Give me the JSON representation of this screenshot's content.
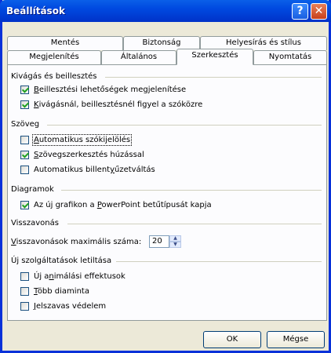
{
  "window": {
    "title": "Beállítások",
    "help_glyph": "?",
    "close_glyph": "✕"
  },
  "tabs": {
    "back_row": [
      "Mentés",
      "Biztonság",
      "Helyesírás és stílus"
    ],
    "front_row": [
      "Megjelenítés",
      "Általános",
      "Szerkesztés",
      "Nyomtatás"
    ],
    "active": "Szerkesztés"
  },
  "groups": {
    "cut_paste": {
      "label": "Kivágás és beillesztés",
      "items": [
        {
          "pre": "",
          "key": "B",
          "post": "eillesztési lehetőségek megjelenítése",
          "checked": true
        },
        {
          "pre": "",
          "key": "K",
          "post": "ivágásnál, beillesztésnél figyel a szóközre",
          "checked": true
        }
      ]
    },
    "text": {
      "label": "Szöveg",
      "items": [
        {
          "pre": "",
          "key": "A",
          "post": "utomatikus szókijelölés",
          "checked": false
        },
        {
          "pre": "",
          "key": "S",
          "post": "zövegszerkesztés húzással",
          "checked": true
        },
        {
          "pre": "Automatikus billent",
          "key": "y",
          "post": "űzetváltás",
          "checked": false
        }
      ]
    },
    "charts": {
      "label": "Diagramok",
      "items": [
        {
          "pre": "Az új grafikon a ",
          "key": "P",
          "post": "owerPoint betűtípusát kapja",
          "checked": true
        }
      ]
    },
    "undo": {
      "label": "Visszavonás",
      "field_pre": "",
      "field_key": "V",
      "field_post": "isszavonások maximális száma:",
      "value": "20",
      "up_glyph": "▲",
      "down_glyph": "▼"
    },
    "services": {
      "label": "Új szolgáltatások letiltása",
      "items": [
        {
          "pre": "Új a",
          "key": "n",
          "post": "imálási effektusok",
          "checked": false
        },
        {
          "pre": "",
          "key": "T",
          "post": "öbb diaminta",
          "checked": false
        },
        {
          "pre": "",
          "key": "J",
          "post": "elszavas védelem",
          "checked": false
        }
      ]
    }
  },
  "buttons": {
    "ok": "OK",
    "cancel": "Mégse"
  },
  "colors": {
    "titlebar": "#0049e0",
    "window_bg": "#ece9d8",
    "check": "#21a121"
  }
}
